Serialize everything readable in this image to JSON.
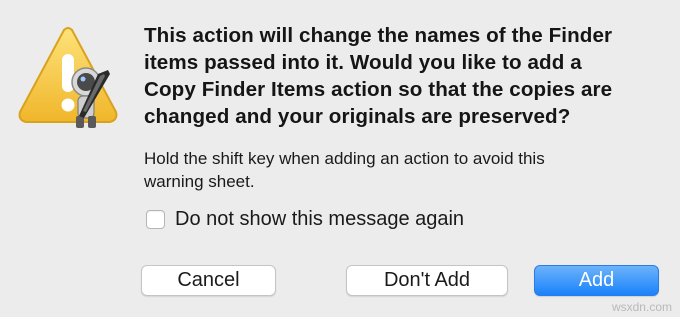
{
  "alert": {
    "message_lines": [
      "This action will change the names of the Finder",
      "items passed into it.  Would you like to add a",
      "Copy Finder Items action so that the copies are",
      "changed and your originals are preserved?"
    ],
    "informative_lines": [
      "Hold the shift key when adding an action to avoid this",
      "warning sheet."
    ],
    "suppress_label": "Do not show this message again",
    "suppress_checked": false
  },
  "buttons": {
    "cancel": "Cancel",
    "dont_add": "Don't Add",
    "add": "Add"
  },
  "icons": {
    "warning": "warning-triangle-icon",
    "badge": "automator-robot-icon"
  },
  "colors": {
    "background": "#ececec",
    "default_button": "#1a82fb",
    "warning_yellow": "#f5c436"
  },
  "watermark": "wsxdn.com"
}
